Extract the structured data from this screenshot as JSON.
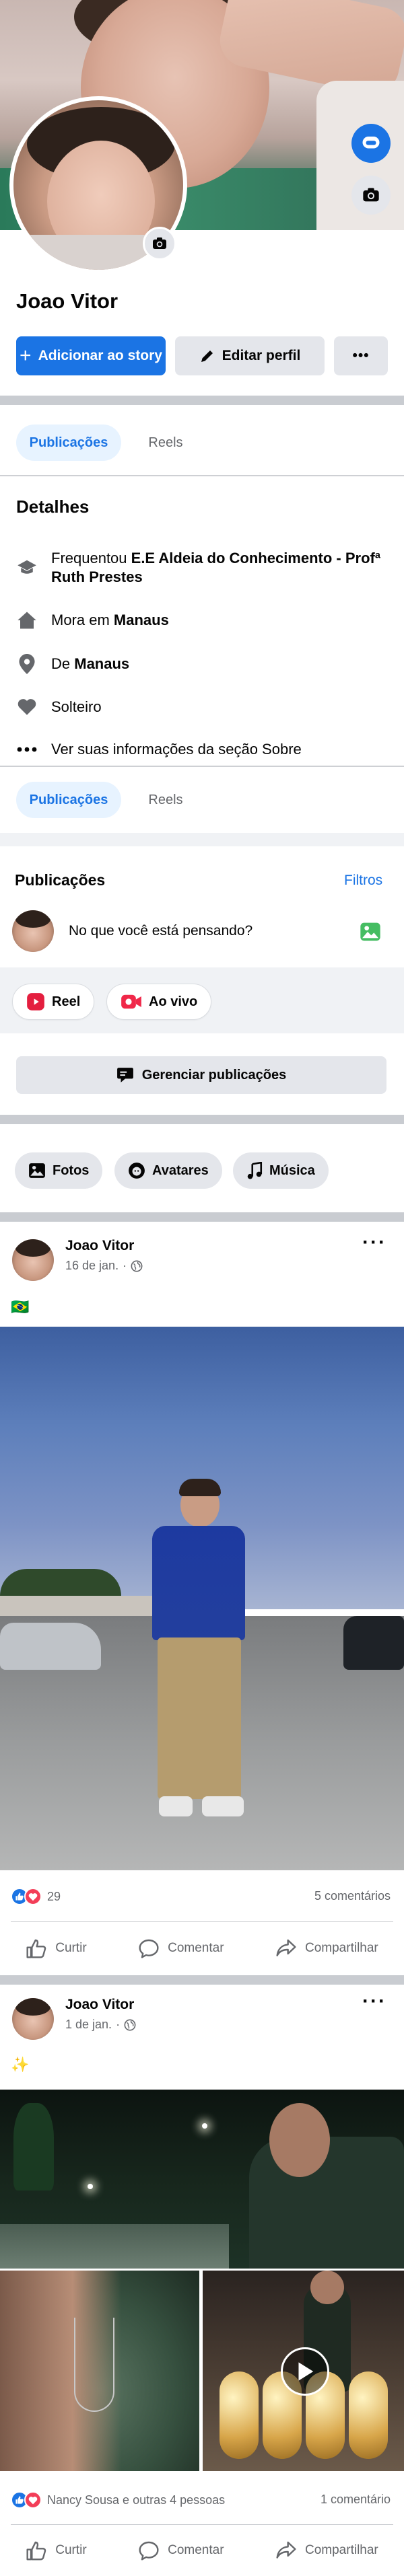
{
  "profile": {
    "name": "Joao Vitor",
    "buttons": {
      "add_story": "Adicionar ao story",
      "edit_profile": "Editar perfil",
      "more": "•••"
    }
  },
  "tabs": {
    "posts": "Publicações",
    "reels": "Reels"
  },
  "details": {
    "title": "Detalhes",
    "studied_prefix": "Frequentou ",
    "studied_school": "E.E Aldeia do Conhecimento - Profª Ruth Prestes",
    "lives_prefix": "Mora em ",
    "lives_city": "Manaus",
    "from_prefix": "De ",
    "from_city": "Manaus",
    "relationship": "Solteiro",
    "see_about": "Ver suas informações da seção Sobre"
  },
  "publications": {
    "title": "Publicações",
    "filters": "Filtros",
    "composer_placeholder": "No que você está pensando?",
    "reel": "Reel",
    "live": "Ao vivo",
    "manage": "Gerenciar publicações"
  },
  "media_chips": {
    "photos": "Fotos",
    "avatars": "Avatares",
    "music": "Música"
  },
  "posts": [
    {
      "author": "Joao Vitor",
      "date": "16 de jan.",
      "text": "🇧🇷",
      "reactions": "29",
      "comments": "5 comentários"
    },
    {
      "author": "Joao Vitor",
      "date": "1 de jan.",
      "text": "✨",
      "reactions": "Nancy Sousa e outras 4 pessoas",
      "comments": "1 comentário"
    }
  ],
  "actions": {
    "like": "Curtir",
    "comment": "Comentar",
    "share": "Compartilhar"
  },
  "colors": {
    "accent": "#1b74e4",
    "divider": "#c9ccd1",
    "muted": "#65676b"
  }
}
